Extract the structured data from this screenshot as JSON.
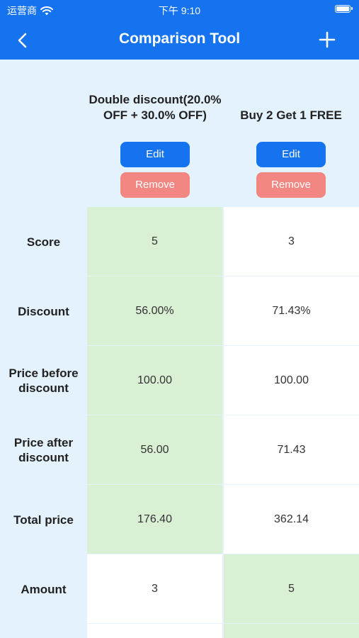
{
  "status_bar": {
    "carrier": "运营商",
    "time": "下午 9:10"
  },
  "nav": {
    "title": "Comparison Tool"
  },
  "columns": [
    {
      "title": "Double discount(20.0% OFF + 30.0% OFF)",
      "edit_label": "Edit",
      "remove_label": "Remove"
    },
    {
      "title": "Buy 2 Get 1 FREE",
      "edit_label": "Edit",
      "remove_label": "Remove"
    }
  ],
  "rows": [
    {
      "label": "Score",
      "values": [
        "5",
        "3"
      ],
      "best": 0
    },
    {
      "label": "Discount",
      "values": [
        "56.00%",
        "71.43%"
      ],
      "best": 0
    },
    {
      "label": "Price before discount",
      "values": [
        "100.00",
        "100.00"
      ],
      "best": 0
    },
    {
      "label": "Price after discount",
      "values": [
        "56.00",
        "71.43"
      ],
      "best": 0
    },
    {
      "label": "Total price",
      "values": [
        "176.40",
        "362.14"
      ],
      "best": 0
    },
    {
      "label": "Amount",
      "values": [
        "3",
        "5"
      ],
      "best": 1
    }
  ],
  "colors": {
    "primary": "#1673f0",
    "remove": "#f28682",
    "best_cell": "#d9f0d4",
    "background": "#e3f2fd"
  }
}
